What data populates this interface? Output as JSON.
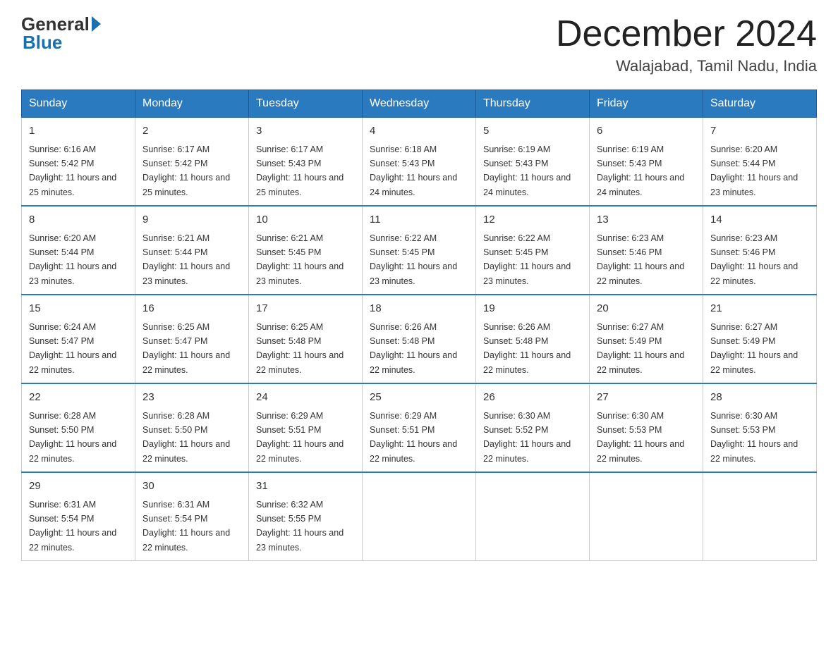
{
  "header": {
    "logo_general": "General",
    "logo_blue": "Blue",
    "title": "December 2024",
    "location": "Walajabad, Tamil Nadu, India"
  },
  "weekdays": [
    "Sunday",
    "Monday",
    "Tuesday",
    "Wednesday",
    "Thursday",
    "Friday",
    "Saturday"
  ],
  "weeks": [
    [
      {
        "day": "1",
        "sunrise": "6:16 AM",
        "sunset": "5:42 PM",
        "daylight": "11 hours and 25 minutes."
      },
      {
        "day": "2",
        "sunrise": "6:17 AM",
        "sunset": "5:42 PM",
        "daylight": "11 hours and 25 minutes."
      },
      {
        "day": "3",
        "sunrise": "6:17 AM",
        "sunset": "5:43 PM",
        "daylight": "11 hours and 25 minutes."
      },
      {
        "day": "4",
        "sunrise": "6:18 AM",
        "sunset": "5:43 PM",
        "daylight": "11 hours and 24 minutes."
      },
      {
        "day": "5",
        "sunrise": "6:19 AM",
        "sunset": "5:43 PM",
        "daylight": "11 hours and 24 minutes."
      },
      {
        "day": "6",
        "sunrise": "6:19 AM",
        "sunset": "5:43 PM",
        "daylight": "11 hours and 24 minutes."
      },
      {
        "day": "7",
        "sunrise": "6:20 AM",
        "sunset": "5:44 PM",
        "daylight": "11 hours and 23 minutes."
      }
    ],
    [
      {
        "day": "8",
        "sunrise": "6:20 AM",
        "sunset": "5:44 PM",
        "daylight": "11 hours and 23 minutes."
      },
      {
        "day": "9",
        "sunrise": "6:21 AM",
        "sunset": "5:44 PM",
        "daylight": "11 hours and 23 minutes."
      },
      {
        "day": "10",
        "sunrise": "6:21 AM",
        "sunset": "5:45 PM",
        "daylight": "11 hours and 23 minutes."
      },
      {
        "day": "11",
        "sunrise": "6:22 AM",
        "sunset": "5:45 PM",
        "daylight": "11 hours and 23 minutes."
      },
      {
        "day": "12",
        "sunrise": "6:22 AM",
        "sunset": "5:45 PM",
        "daylight": "11 hours and 23 minutes."
      },
      {
        "day": "13",
        "sunrise": "6:23 AM",
        "sunset": "5:46 PM",
        "daylight": "11 hours and 22 minutes."
      },
      {
        "day": "14",
        "sunrise": "6:23 AM",
        "sunset": "5:46 PM",
        "daylight": "11 hours and 22 minutes."
      }
    ],
    [
      {
        "day": "15",
        "sunrise": "6:24 AM",
        "sunset": "5:47 PM",
        "daylight": "11 hours and 22 minutes."
      },
      {
        "day": "16",
        "sunrise": "6:25 AM",
        "sunset": "5:47 PM",
        "daylight": "11 hours and 22 minutes."
      },
      {
        "day": "17",
        "sunrise": "6:25 AM",
        "sunset": "5:48 PM",
        "daylight": "11 hours and 22 minutes."
      },
      {
        "day": "18",
        "sunrise": "6:26 AM",
        "sunset": "5:48 PM",
        "daylight": "11 hours and 22 minutes."
      },
      {
        "day": "19",
        "sunrise": "6:26 AM",
        "sunset": "5:48 PM",
        "daylight": "11 hours and 22 minutes."
      },
      {
        "day": "20",
        "sunrise": "6:27 AM",
        "sunset": "5:49 PM",
        "daylight": "11 hours and 22 minutes."
      },
      {
        "day": "21",
        "sunrise": "6:27 AM",
        "sunset": "5:49 PM",
        "daylight": "11 hours and 22 minutes."
      }
    ],
    [
      {
        "day": "22",
        "sunrise": "6:28 AM",
        "sunset": "5:50 PM",
        "daylight": "11 hours and 22 minutes."
      },
      {
        "day": "23",
        "sunrise": "6:28 AM",
        "sunset": "5:50 PM",
        "daylight": "11 hours and 22 minutes."
      },
      {
        "day": "24",
        "sunrise": "6:29 AM",
        "sunset": "5:51 PM",
        "daylight": "11 hours and 22 minutes."
      },
      {
        "day": "25",
        "sunrise": "6:29 AM",
        "sunset": "5:51 PM",
        "daylight": "11 hours and 22 minutes."
      },
      {
        "day": "26",
        "sunrise": "6:30 AM",
        "sunset": "5:52 PM",
        "daylight": "11 hours and 22 minutes."
      },
      {
        "day": "27",
        "sunrise": "6:30 AM",
        "sunset": "5:53 PM",
        "daylight": "11 hours and 22 minutes."
      },
      {
        "day": "28",
        "sunrise": "6:30 AM",
        "sunset": "5:53 PM",
        "daylight": "11 hours and 22 minutes."
      }
    ],
    [
      {
        "day": "29",
        "sunrise": "6:31 AM",
        "sunset": "5:54 PM",
        "daylight": "11 hours and 22 minutes."
      },
      {
        "day": "30",
        "sunrise": "6:31 AM",
        "sunset": "5:54 PM",
        "daylight": "11 hours and 22 minutes."
      },
      {
        "day": "31",
        "sunrise": "6:32 AM",
        "sunset": "5:55 PM",
        "daylight": "11 hours and 23 minutes."
      },
      null,
      null,
      null,
      null
    ]
  ]
}
